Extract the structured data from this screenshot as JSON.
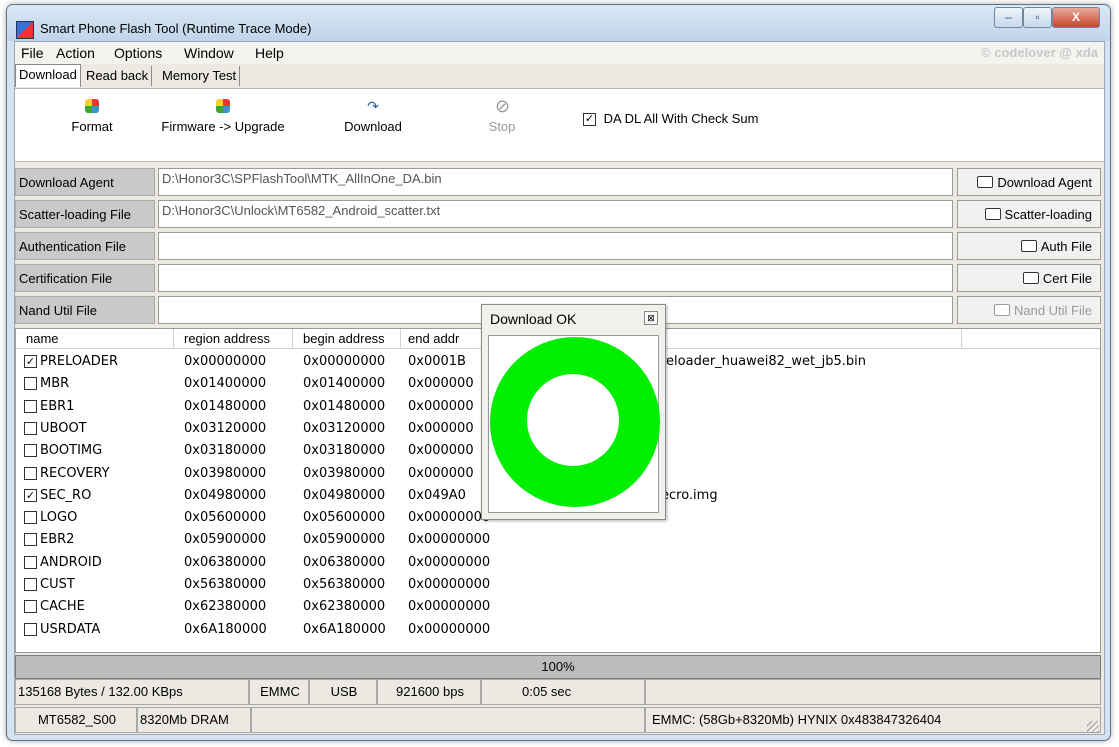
{
  "window": {
    "title": "Smart Phone Flash Tool (Runtime Trace Mode)",
    "min": "–",
    "max": "▫",
    "close": "X"
  },
  "menu": {
    "items": [
      "File",
      "Action",
      "Options",
      "Window",
      "Help"
    ],
    "watermark": "© codelover @ xda"
  },
  "tabs": [
    "Download",
    "Read back",
    "Memory Test"
  ],
  "toolbar": {
    "format": "Format",
    "firmware_upgrade": "Firmware -> Upgrade",
    "download": "Download",
    "stop": "Stop",
    "da_checkbox_label": "DA DL All With Check Sum",
    "da_checked": true
  },
  "files": [
    {
      "label": "Download Agent",
      "value": "D:\\Honor3C\\SPFlashTool\\MTK_AllInOne_DA.bin",
      "button": "Download Agent",
      "enabled": true
    },
    {
      "label": "Scatter-loading File",
      "value": "D:\\Honor3C\\Unlock\\MT6582_Android_scatter.txt",
      "button": "Scatter-loading",
      "enabled": true
    },
    {
      "label": "Authentication File",
      "value": "",
      "button": "Auth File",
      "enabled": true
    },
    {
      "label": "Certification File",
      "value": "",
      "button": "Cert File",
      "enabled": true
    },
    {
      "label": "Nand Util File",
      "value": "",
      "button": "Nand Util File",
      "enabled": false
    }
  ],
  "table": {
    "columns": [
      "name",
      "region address",
      "begin address",
      "end addr"
    ],
    "rows": [
      {
        "checked": true,
        "name": "PRELOADER",
        "region": "0x00000000",
        "begin": "0x00000000",
        "end": "0x0001B",
        "location": "reloader_huawei82_wet_jb5.bin"
      },
      {
        "checked": false,
        "name": "MBR",
        "region": "0x01400000",
        "begin": "0x01400000",
        "end": "0x000000",
        "location": ""
      },
      {
        "checked": false,
        "name": "EBR1",
        "region": "0x01480000",
        "begin": "0x01480000",
        "end": "0x000000",
        "location": ""
      },
      {
        "checked": false,
        "name": "UBOOT",
        "region": "0x03120000",
        "begin": "0x03120000",
        "end": "0x000000",
        "location": ""
      },
      {
        "checked": false,
        "name": "BOOTIMG",
        "region": "0x03180000",
        "begin": "0x03180000",
        "end": "0x000000",
        "location": ""
      },
      {
        "checked": false,
        "name": "RECOVERY",
        "region": "0x03980000",
        "begin": "0x03980000",
        "end": "0x000000",
        "location": ""
      },
      {
        "checked": true,
        "name": "SEC_RO",
        "region": "0x04980000",
        "begin": "0x04980000",
        "end": "0x049A0",
        "location": "ecro.img"
      },
      {
        "checked": false,
        "name": "LOGO",
        "region": "0x05600000",
        "begin": "0x05600000",
        "end": "0x00000000",
        "location": ""
      },
      {
        "checked": false,
        "name": "EBR2",
        "region": "0x05900000",
        "begin": "0x05900000",
        "end": "0x00000000",
        "location": ""
      },
      {
        "checked": false,
        "name": "ANDROID",
        "region": "0x06380000",
        "begin": "0x06380000",
        "end": "0x00000000",
        "location": ""
      },
      {
        "checked": false,
        "name": "CUST",
        "region": "0x56380000",
        "begin": "0x56380000",
        "end": "0x00000000",
        "location": ""
      },
      {
        "checked": false,
        "name": "CACHE",
        "region": "0x62380000",
        "begin": "0x62380000",
        "end": "0x00000000",
        "location": ""
      },
      {
        "checked": false,
        "name": "USRDATA",
        "region": "0x6A180000",
        "begin": "0x6A180000",
        "end": "0x00000000",
        "location": ""
      }
    ]
  },
  "dialog": {
    "title": "Download OK",
    "close": "⊠",
    "ring_color": "#00ee00"
  },
  "progress": {
    "text": "100%",
    "fraction": 1.0
  },
  "status1": {
    "speed": "135168 Bytes / 132.00 KBps",
    "storage": "EMMC",
    "port": "USB",
    "baud": "921600 bps",
    "time": "0:05 sec"
  },
  "status2": {
    "chip": "MT6582_S00",
    "dram": "8320Mb DRAM",
    "emmc": "EMMC: (58Gb+8320Mb) HYNIX 0x483847326404"
  }
}
